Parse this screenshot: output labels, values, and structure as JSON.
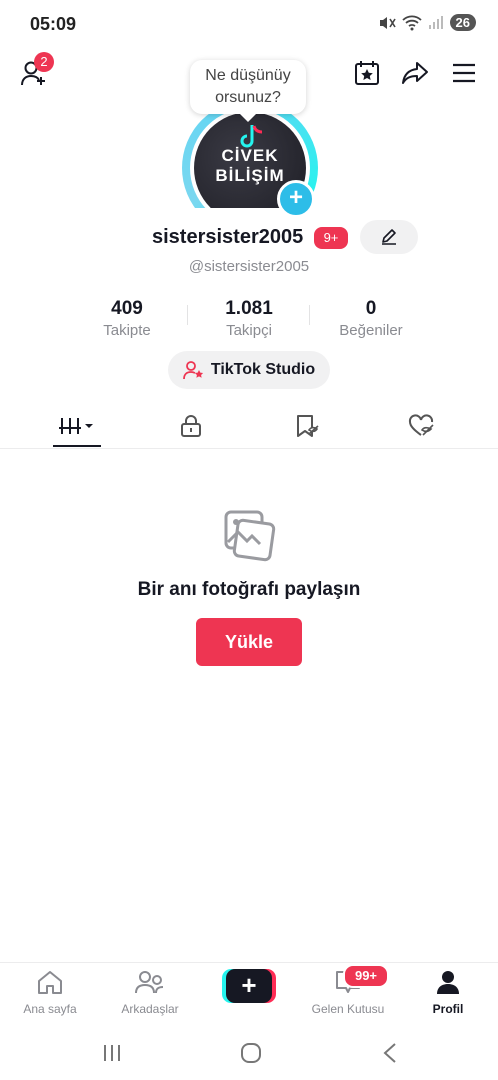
{
  "status_bar": {
    "time": "05:09",
    "battery": "26"
  },
  "top_bar": {
    "friend_requests_badge": "2",
    "bubble_line1": "Ne düşünüy",
    "bubble_line2": "orsunuz?"
  },
  "avatar": {
    "text_line1": "CİVEK",
    "text_line2": "BİLİŞİM"
  },
  "profile": {
    "username": "sistersister2005",
    "username_badge": "9+",
    "handle": "@sistersister2005"
  },
  "stats": [
    {
      "value": "409",
      "label": "Takipte"
    },
    {
      "value": "1.081",
      "label": "Takipçi"
    },
    {
      "value": "0",
      "label": "Beğeniler"
    }
  ],
  "studio_button": "TikTok Studio",
  "empty_state": {
    "title": "Bir anı fotoğrafı paylaşın",
    "button": "Yükle"
  },
  "bottom_nav": {
    "home": "Ana sayfa",
    "friends": "Arkadaşlar",
    "inbox": "Gelen Kutusu",
    "inbox_badge": "99+",
    "profile": "Profil"
  },
  "colors": {
    "accent": "#ee3552",
    "ring": "#5fd6f3",
    "text": "#161823",
    "muted": "#8a8b91"
  }
}
